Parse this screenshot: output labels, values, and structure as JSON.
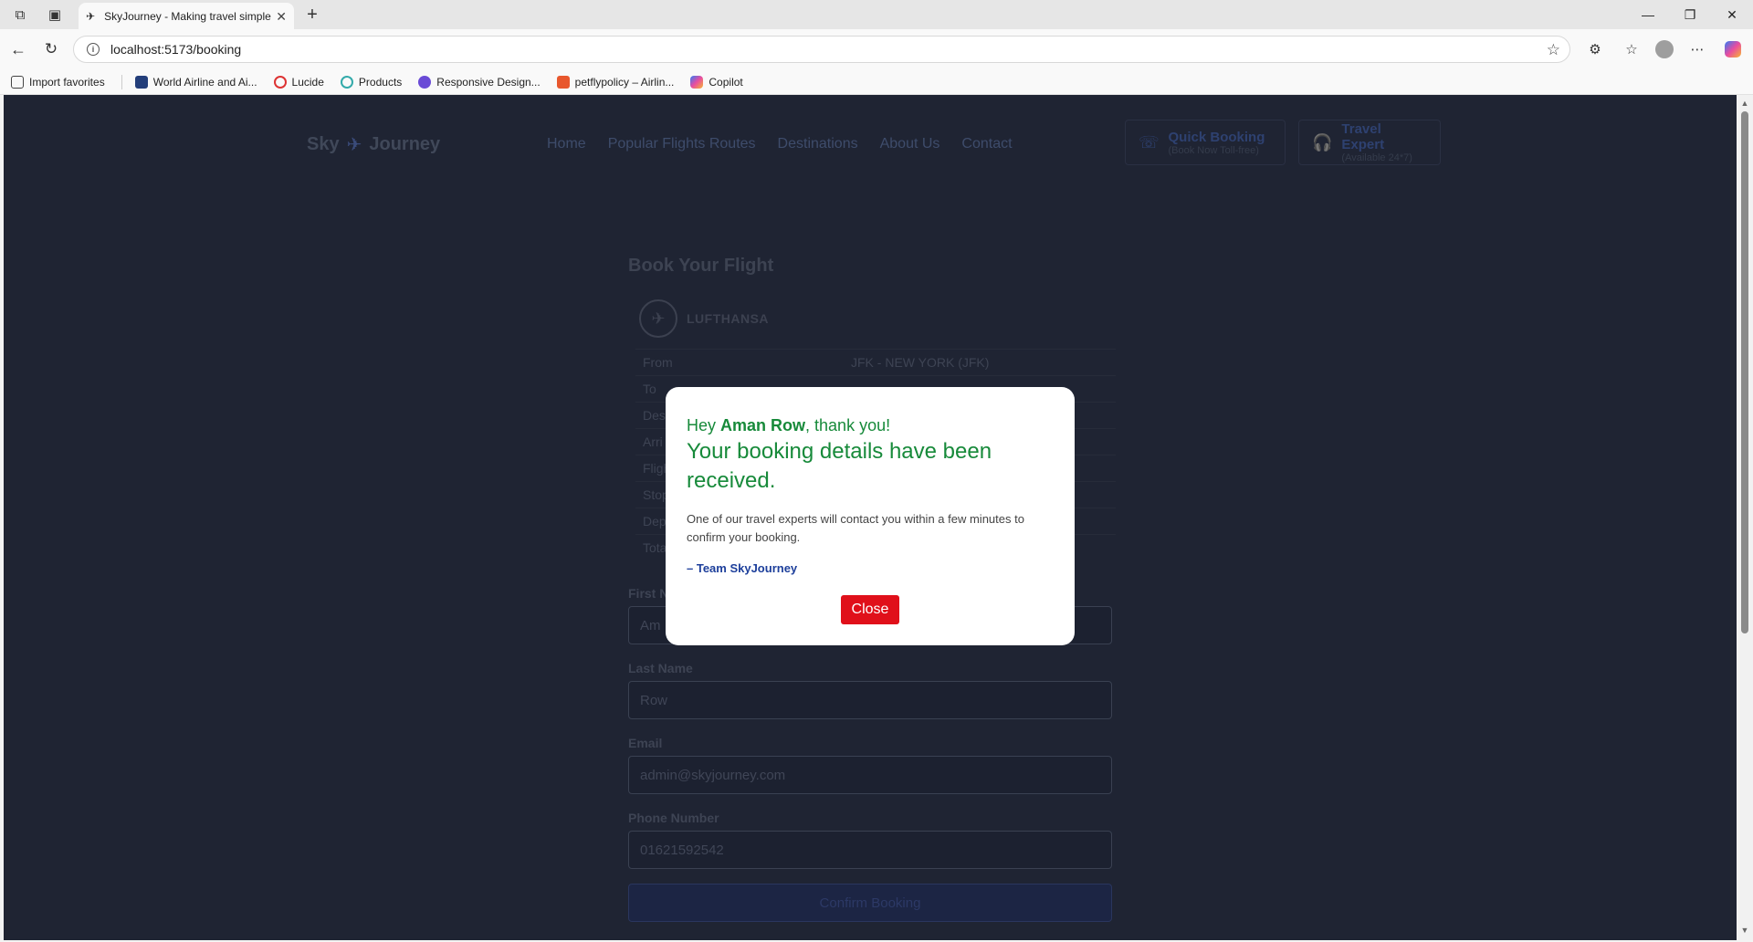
{
  "browser": {
    "tab_title": "SkyJourney - Making travel simple",
    "url": "localhost:5173/booking",
    "favorites": [
      {
        "label": "Import favorites"
      },
      {
        "label": "World Airline and Ai..."
      },
      {
        "label": "Lucide"
      },
      {
        "label": "Products"
      },
      {
        "label": "Responsive Design..."
      },
      {
        "label": "petflypolicy – Airlin..."
      },
      {
        "label": "Copilot"
      }
    ]
  },
  "site": {
    "logo_left": "Sky",
    "logo_right": "Journey",
    "nav": [
      "Home",
      "Popular Flights Routes",
      "Destinations",
      "About Us",
      "Contact"
    ],
    "quick_booking": {
      "title": "Quick Booking",
      "sub": "(Book Now Toll-free)"
    },
    "travel_expert": {
      "title": "Travel Expert",
      "sub": "(Available 24*7)"
    }
  },
  "booking": {
    "title": "Book Your Flight",
    "airline": "LUFTHANSA",
    "rows": [
      {
        "label": "From",
        "value": "JFK - NEW YORK (JFK)"
      },
      {
        "label": "To",
        "value": ""
      },
      {
        "label": "Des",
        "value": ""
      },
      {
        "label": "Arri",
        "value": ""
      },
      {
        "label": "Fligh",
        "value": ""
      },
      {
        "label": "Stop",
        "value": ""
      },
      {
        "label": "Dep",
        "value": ""
      },
      {
        "label": "Tota",
        "value": ""
      }
    ],
    "first_name_label": "First N",
    "first_name_value": "Am",
    "last_name_label": "Last Name",
    "last_name_value": "Row",
    "email_label": "Email",
    "email_value": "admin@skyjourney.com",
    "phone_label": "Phone Number",
    "phone_value": "01621592542",
    "confirm_label": "Confirm Booking"
  },
  "modal": {
    "greet_prefix": "Hey ",
    "name": "Aman Row",
    "greet_suffix": ", thank you!",
    "headline": "Your booking details have been received.",
    "body": "One of our travel experts will contact you within a few minutes to confirm your booking.",
    "sign": "– Team SkyJourney",
    "close_label": "Close"
  }
}
